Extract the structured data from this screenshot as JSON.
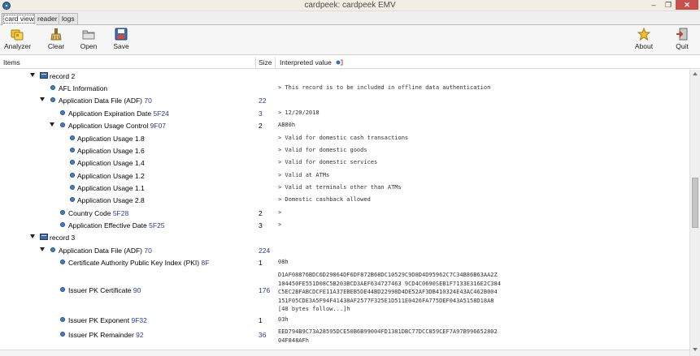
{
  "window": {
    "title": "cardpeek: cardpeek EMV",
    "minimize": "–",
    "maximize": "❐",
    "close": "✕"
  },
  "tabs": [
    {
      "label": "card view"
    },
    {
      "label": "reader"
    },
    {
      "label": "logs"
    }
  ],
  "toolbar": {
    "analyzer": "Analyzer",
    "clear": "Clear",
    "open": "Open",
    "save": "Save",
    "about": "About",
    "quit": "Quit"
  },
  "columns": {
    "items": "Items",
    "size": "Size",
    "value": "Interpreted value"
  },
  "icons": {
    "record": "record-icon",
    "node": "node-icon",
    "expander": "expander-icon"
  },
  "colors": {
    "node_blue": "#4a7dbf",
    "size_blue": "#2a3d9a",
    "close_red": "#c7504c"
  },
  "rows": [
    {
      "name": "record 2",
      "size": "",
      "value": ""
    },
    {
      "name": "AFL Information",
      "size": "",
      "value": "> This record is to be included in offline data authentication"
    },
    {
      "name": "Application Data File (ADF)",
      "tag": "70",
      "size": "22",
      "value": ""
    },
    {
      "name": "Application Expiration Date",
      "tag": "5F24",
      "size": "3",
      "value": "> 12/20/2018"
    },
    {
      "name": "Application Usage Control",
      "tag": "9F07",
      "size": "2",
      "value": "AB80h"
    },
    {
      "name": "Application Usage 1.8",
      "size": "",
      "value": "> Valid for domestic cash transactions"
    },
    {
      "name": "Application Usage 1.6",
      "size": "",
      "value": "> Valid for domestic goods"
    },
    {
      "name": "Application Usage 1.4",
      "size": "",
      "value": "> Valid for domestic services"
    },
    {
      "name": "Application Usage 1.2",
      "size": "",
      "value": "> Valid at ATMs"
    },
    {
      "name": "Application Usage 1.1",
      "size": "",
      "value": "> Valid at terminals other than ATMs"
    },
    {
      "name": "Application Usage 2.8",
      "size": "",
      "value": "> Domestic cashback allowed"
    },
    {
      "name": "Country Code",
      "tag": "5F28",
      "size": "2",
      "value": ">"
    },
    {
      "name": "Application Effective Date",
      "tag": "5F25",
      "size": "3",
      "value": ">"
    },
    {
      "name": "record 3",
      "size": "",
      "value": ""
    },
    {
      "name": "Application Data File (ADF)",
      "tag": "70",
      "size": "224",
      "value": ""
    },
    {
      "name": "Certificate Authority Public Key Index (PKI)",
      "tag": "8F",
      "size": "1",
      "value": "08h"
    },
    {
      "name": "Issuer PK Certificate",
      "tag": "90",
      "size": "176",
      "value": "D1AF08876BDC6D29864DF6DF872B68DC10529C9D8D4D95962C7C34B86B63AA2Z\n104450FE551D08C5B203BCD3AEF634727463 9CD4C0690SEB1F7133E316E2C384\nC5EC2BFABCDCFE11A37EBEB5DE44BD22998D4DE52AF3DB410324E43AC462B004\n151F05CDE3A5F94F41438AF2577F325E1D511E0426FA775DEF043A5158D18A8\n[48 bytes follow...]h"
    },
    {
      "name": "Issuer PK Exponent",
      "tag": "9F32",
      "size": "1",
      "value": "03h"
    },
    {
      "name": "Issuer PK Remainder",
      "tag": "92",
      "size": "36",
      "value": "EED794B9C73A28595DCE50B6B99004FD1381DBC77DCC859CEF7A97B996652802\n04F848AFh"
    }
  ]
}
